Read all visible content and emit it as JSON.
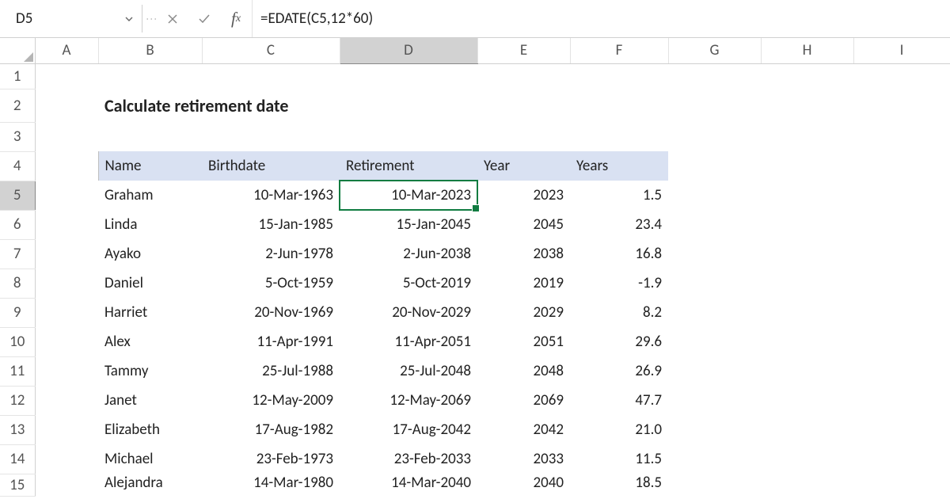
{
  "name_box": "D5",
  "formula": "=EDATE(C5,12*60)",
  "columns": [
    "A",
    "B",
    "C",
    "D",
    "E",
    "F",
    "G",
    "H",
    "I"
  ],
  "rows": [
    "1",
    "2",
    "3",
    "4",
    "5",
    "6",
    "7",
    "8",
    "9",
    "10",
    "11",
    "12",
    "13",
    "14",
    "15"
  ],
  "active_col": "D",
  "active_row": "5",
  "title": "Calculate retirement date",
  "headers": {
    "name": "Name",
    "birthdate": "Birthdate",
    "retirement": "Retirement",
    "year": "Year",
    "years": "Years"
  },
  "records": [
    {
      "row": "5",
      "name": "Graham",
      "birthdate": "10-Mar-1963",
      "retirement": "10-Mar-2023",
      "year": "2023",
      "years": "1.5"
    },
    {
      "row": "6",
      "name": "Linda",
      "birthdate": "15-Jan-1985",
      "retirement": "15-Jan-2045",
      "year": "2045",
      "years": "23.4"
    },
    {
      "row": "7",
      "name": "Ayako",
      "birthdate": "2-Jun-1978",
      "retirement": "2-Jun-2038",
      "year": "2038",
      "years": "16.8"
    },
    {
      "row": "8",
      "name": "Daniel",
      "birthdate": "5-Oct-1959",
      "retirement": "5-Oct-2019",
      "year": "2019",
      "years": "-1.9"
    },
    {
      "row": "9",
      "name": "Harriet",
      "birthdate": "20-Nov-1969",
      "retirement": "20-Nov-2029",
      "year": "2029",
      "years": "8.2"
    },
    {
      "row": "10",
      "name": "Alex",
      "birthdate": "11-Apr-1991",
      "retirement": "11-Apr-2051",
      "year": "2051",
      "years": "29.6"
    },
    {
      "row": "11",
      "name": "Tammy",
      "birthdate": "25-Jul-1988",
      "retirement": "25-Jul-2048",
      "year": "2048",
      "years": "26.9"
    },
    {
      "row": "12",
      "name": "Janet",
      "birthdate": "12-May-2009",
      "retirement": "12-May-2069",
      "year": "2069",
      "years": "47.7"
    },
    {
      "row": "13",
      "name": "Elizabeth",
      "birthdate": "17-Aug-1982",
      "retirement": "17-Aug-2042",
      "year": "2042",
      "years": "21.0"
    },
    {
      "row": "14",
      "name": "Michael",
      "birthdate": "23-Feb-1973",
      "retirement": "23-Feb-2033",
      "year": "2033",
      "years": "11.5"
    },
    {
      "row": "15",
      "name": "Alejandra",
      "birthdate": "14-Mar-1980",
      "retirement": "14-Mar-2040",
      "year": "2040",
      "years": "18.5"
    }
  ],
  "chart_data": {
    "type": "table",
    "title": "Calculate retirement date",
    "columns": [
      "Name",
      "Birthdate",
      "Retirement",
      "Year",
      "Years"
    ],
    "rows": [
      [
        "Graham",
        "10-Mar-1963",
        "10-Mar-2023",
        2023,
        1.5
      ],
      [
        "Linda",
        "15-Jan-1985",
        "15-Jan-2045",
        2045,
        23.4
      ],
      [
        "Ayako",
        "2-Jun-1978",
        "2-Jun-2038",
        2038,
        16.8
      ],
      [
        "Daniel",
        "5-Oct-1959",
        "5-Oct-2019",
        2019,
        -1.9
      ],
      [
        "Harriet",
        "20-Nov-1969",
        "20-Nov-2029",
        2029,
        8.2
      ],
      [
        "Alex",
        "11-Apr-1991",
        "11-Apr-2051",
        2051,
        29.6
      ],
      [
        "Tammy",
        "25-Jul-1988",
        "25-Jul-2048",
        2048,
        26.9
      ],
      [
        "Janet",
        "12-May-2009",
        "12-May-2069",
        2069,
        47.7
      ],
      [
        "Elizabeth",
        "17-Aug-1982",
        "17-Aug-2042",
        2042,
        21.0
      ],
      [
        "Michael",
        "23-Feb-1973",
        "23-Feb-2033",
        2033,
        11.5
      ],
      [
        "Alejandra",
        "14-Mar-1980",
        "14-Mar-2040",
        2040,
        18.5
      ]
    ]
  }
}
